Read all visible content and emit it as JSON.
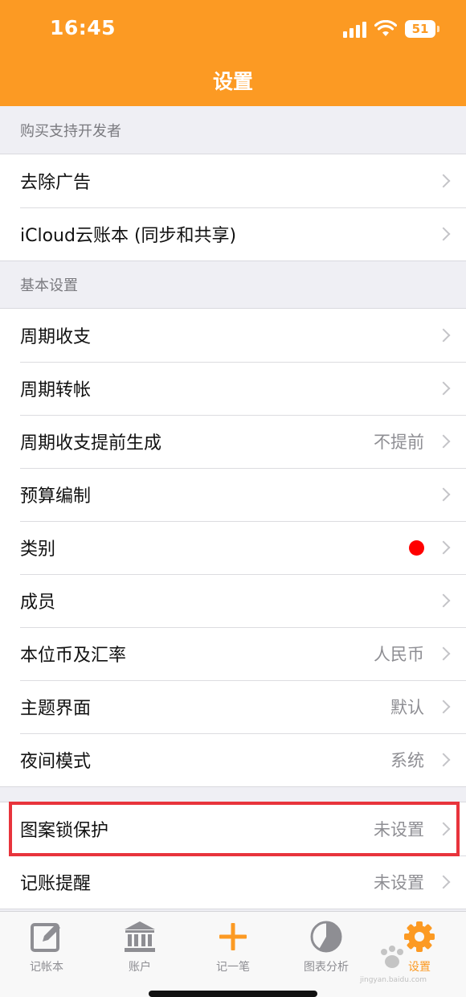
{
  "status_bar": {
    "time": "16:45",
    "battery": "51"
  },
  "nav": {
    "title": "设置"
  },
  "sections": [
    {
      "header": "购买支持开发者",
      "rows": [
        {
          "label": "去除广告",
          "value": ""
        },
        {
          "label": "iCloud云账本 (同步和共享)",
          "value": ""
        }
      ]
    },
    {
      "header": "基本设置",
      "rows": [
        {
          "label": "周期收支",
          "value": ""
        },
        {
          "label": "周期转帐",
          "value": ""
        },
        {
          "label": "周期收支提前生成",
          "value": "不提前"
        },
        {
          "label": "预算编制",
          "value": ""
        },
        {
          "label": "类别",
          "value": "",
          "badge": "red-dot"
        },
        {
          "label": "成员",
          "value": ""
        },
        {
          "label": "本位币及汇率",
          "value": "人民币"
        },
        {
          "label": "主题界面",
          "value": "默认"
        },
        {
          "label": "夜间模式",
          "value": "系统"
        }
      ]
    },
    {
      "header": "",
      "rows": [
        {
          "label": "图案锁保护",
          "value": "未设置"
        },
        {
          "label": "记账提醒",
          "value": "未设置"
        }
      ]
    }
  ],
  "tabbar": [
    {
      "label": "记帐本",
      "icon": "edit-icon"
    },
    {
      "label": "账户",
      "icon": "bank-icon"
    },
    {
      "label": "记一笔",
      "icon": "plus-icon"
    },
    {
      "label": "图表分析",
      "icon": "pie-chart-icon"
    },
    {
      "label": "设置",
      "icon": "gear-icon",
      "active": true
    }
  ],
  "colors": {
    "accent": "#fc9a23",
    "badge": "#ff0000",
    "highlight": "#e8343c"
  },
  "watermark": {
    "text": "jingyan.baidu.com"
  }
}
